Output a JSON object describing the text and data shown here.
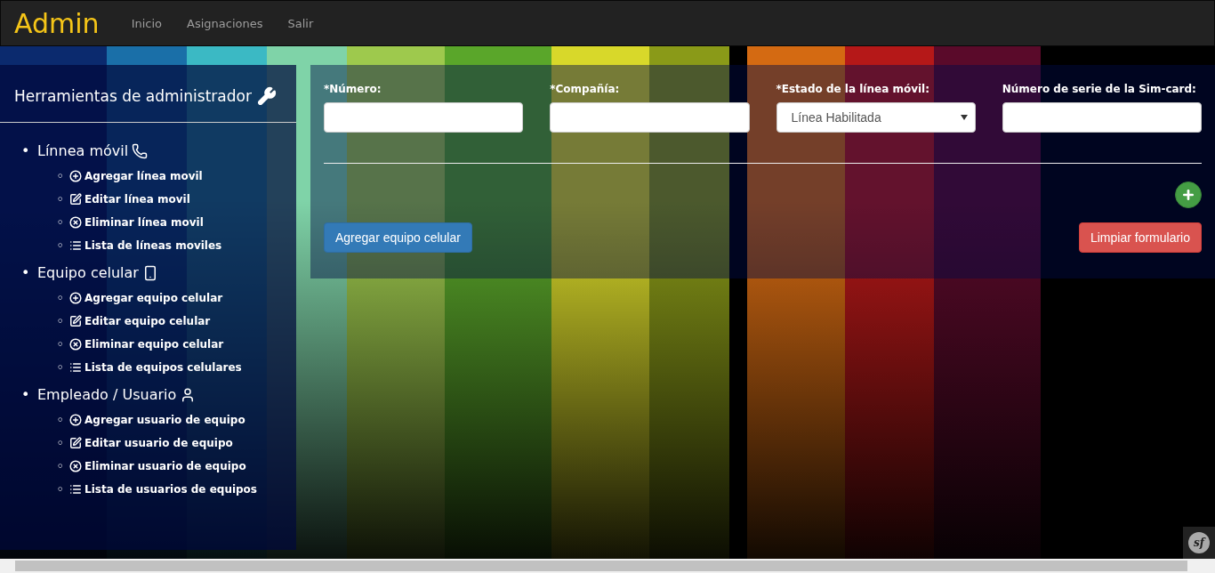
{
  "navbar": {
    "brand": "Admin",
    "links": [
      {
        "label": "Inicio"
      },
      {
        "label": "Asignaciones"
      },
      {
        "label": "Salir"
      }
    ]
  },
  "sidebar": {
    "title": "Herramientas de administrador",
    "sections": [
      {
        "marker": "•",
        "label": "Línnea móvil",
        "items": [
          {
            "marker": "◦",
            "label": "Agregar línea movil"
          },
          {
            "marker": "◦",
            "label": "Editar línea movil"
          },
          {
            "marker": "◦",
            "label": "Eliminar línea movil"
          },
          {
            "marker": "◦",
            "label": "Lista de líneas moviles"
          }
        ]
      },
      {
        "marker": "•",
        "label": "Equipo celular",
        "items": [
          {
            "marker": "◦",
            "label": "Agregar equipo celular"
          },
          {
            "marker": "◦",
            "label": "Editar equipo celular"
          },
          {
            "marker": "◦",
            "label": "Eliminar equipo celular"
          },
          {
            "marker": "◦",
            "label": "Lista de equipos celulares"
          }
        ]
      },
      {
        "marker": "•",
        "label": "Empleado / Usuario",
        "items": [
          {
            "marker": "◦",
            "label": "Agregar usuario de equipo"
          },
          {
            "marker": "◦",
            "label": "Editar usuario de equipo"
          },
          {
            "marker": "◦",
            "label": "Eliminar usuario de equipo"
          },
          {
            "marker": "◦",
            "label": "Lista de usuarios de equipos"
          }
        ]
      }
    ]
  },
  "form": {
    "fields": [
      {
        "label": "*Número:",
        "kind": "text"
      },
      {
        "label": "*Compañía:",
        "kind": "text"
      },
      {
        "label": "*Estado de la línea móvil:",
        "kind": "select",
        "value": "Línea Habilitada"
      },
      {
        "label": "Número de serie de la Sim-card:",
        "kind": "text"
      }
    ],
    "primary_button": "Agregar equipo celular",
    "reset_button": "Limpiar formulario"
  },
  "debug_toolbar": {
    "label": "sf"
  }
}
